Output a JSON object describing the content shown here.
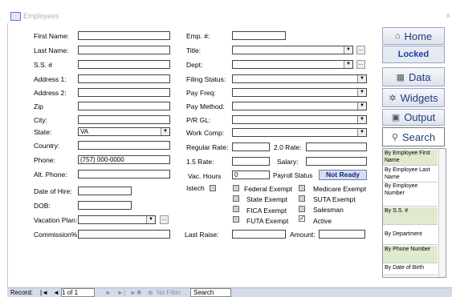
{
  "window": {
    "title": "Employees",
    "close": "x"
  },
  "left": {
    "first_name": {
      "label": "First Name:",
      "value": ""
    },
    "last_name": {
      "label": "Last Name:",
      "value": ""
    },
    "ssn": {
      "label": "S.S. #",
      "value": ""
    },
    "address1": {
      "label": "Address 1:",
      "value": ""
    },
    "address2": {
      "label": "Address 2:",
      "value": ""
    },
    "zip": {
      "label": "Zip",
      "value": ""
    },
    "city": {
      "label": "City:",
      "value": ""
    },
    "state": {
      "label": "State:",
      "value": "VA"
    },
    "country": {
      "label": "Country:",
      "value": ""
    },
    "phone": {
      "label": "Phone:",
      "value": "(757) 000-0000"
    },
    "alt_phone": {
      "label": "Alt. Phone:",
      "value": ""
    },
    "date_of_hire": {
      "label": "Date of Hire:",
      "value": ""
    },
    "dob": {
      "label": "DOB:",
      "value": ""
    },
    "vacation_plan": {
      "label": "Vacation Plan:",
      "value": ""
    },
    "commission": {
      "label": "Commission%:",
      "value": ""
    }
  },
  "middle": {
    "emp_no": {
      "label": "Emp. #:",
      "value": ""
    },
    "title": {
      "label": "Title:",
      "value": ""
    },
    "dept": {
      "label": "Dept:",
      "value": ""
    },
    "filing_status": {
      "label": "Filing Status:",
      "value": ""
    },
    "pay_freq": {
      "label": "Pay Freq:",
      "value": ""
    },
    "pay_method": {
      "label": "Pay Method:",
      "value": ""
    },
    "pr_gl": {
      "label": "P/R  GL:",
      "value": ""
    },
    "work_comp": {
      "label": "Work Comp:",
      "value": ""
    },
    "regular_rate": {
      "label": "Regular Rate:",
      "value": ""
    },
    "rate_2": {
      "label": "2.0 Rate:",
      "value": ""
    },
    "rate_15": {
      "label": "1.5 Rate:",
      "value": ""
    },
    "salary": {
      "label": "Salary:",
      "value": ""
    },
    "vac_hours": {
      "label": "Vac. Hours",
      "value": "0"
    },
    "payroll_status": {
      "label": "Payroll Status",
      "value": "Not Ready"
    },
    "istech": {
      "label": "Istech"
    },
    "last_raise": {
      "label": "Last Raise:",
      "value": ""
    },
    "amount": {
      "label": "Amount:",
      "value": ""
    }
  },
  "checkboxes": {
    "federal_exempt": "Federal Exempt",
    "state_exempt": "State Exempt",
    "fica_exempt": "FICA Exempt",
    "futa_exempt": "FUTA Exempt",
    "medicare_exempt": "Medicare Exempt",
    "suta_exempt": "SUTA Exempt",
    "salesman": "Salesman",
    "active": "Active"
  },
  "nav": {
    "home": "Home",
    "locked": "Locked",
    "data": "Data",
    "widgets": "Widgets",
    "output": "Output",
    "search": "Search"
  },
  "sort_list": [
    "By Employee First Name",
    "By Employee Last Name",
    "By Employee Number",
    "By S.S. #",
    "By Department",
    "By Phone Number",
    "By Date of Birth"
  ],
  "statusbar": {
    "record_label": "Record:",
    "record_value": "1 of 1",
    "no_filter": "No Filter",
    "search": "Search"
  }
}
